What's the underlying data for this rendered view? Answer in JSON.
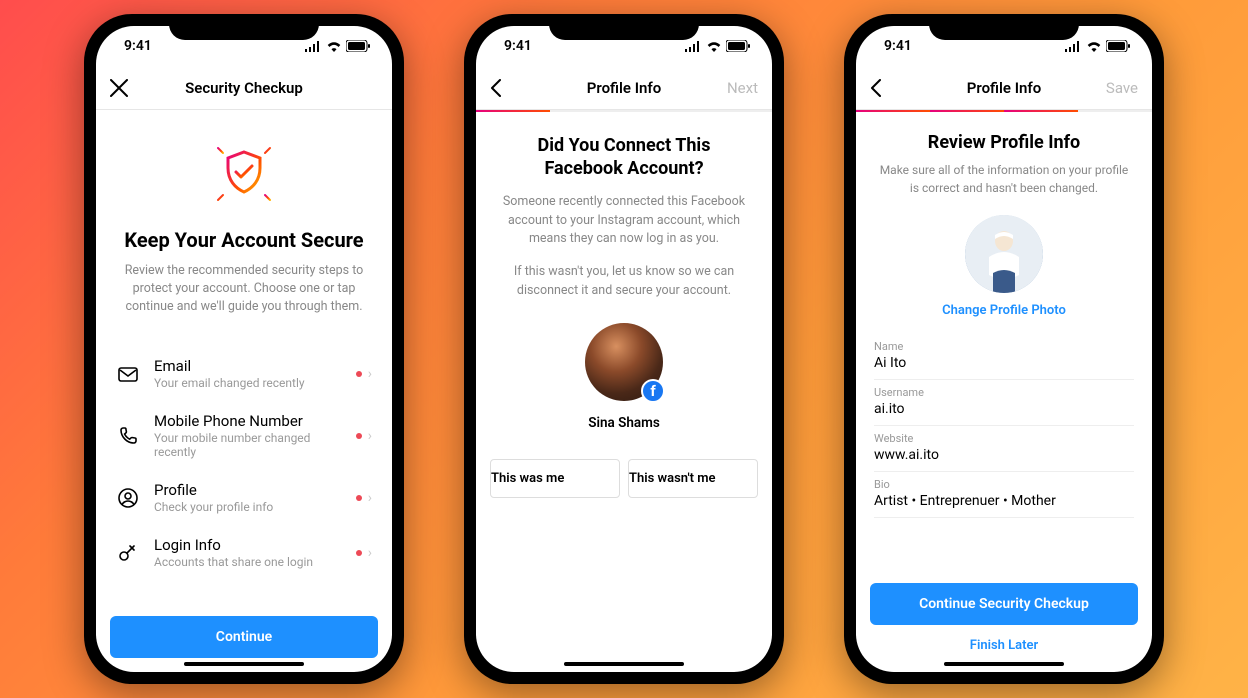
{
  "status": {
    "time": "9:41"
  },
  "screen1": {
    "nav_title": "Security Checkup",
    "hero_title": "Keep Your Account Secure",
    "hero_sub": "Review the recommended security steps to protect your account. Choose one or tap continue and we'll guide you through them.",
    "items": [
      {
        "title": "Email",
        "sub": "Your email changed recently"
      },
      {
        "title": "Mobile Phone Number",
        "sub": "Your mobile number changed recently"
      },
      {
        "title": "Profile",
        "sub": "Check your profile info"
      },
      {
        "title": "Login Info",
        "sub": "Accounts that share one login"
      }
    ],
    "continue_label": "Continue"
  },
  "screen2": {
    "nav_title": "Profile Info",
    "nav_right": "Next",
    "h1": "Did You Connect This Facebook Account?",
    "p1": "Someone recently connected this Facebook account to your Instagram account, which means they can now log in as you.",
    "p2": "If this wasn't you, let us know so we can disconnect it and secure your account.",
    "avatar_name": "Sina Shams",
    "btn_yes": "This was me",
    "btn_no": "This wasn't me"
  },
  "screen3": {
    "nav_title": "Profile Info",
    "nav_right": "Save",
    "h1": "Review Profile Info",
    "sub": "Make sure all of the information on your profile is correct and hasn't been changed.",
    "change_photo": "Change Profile Photo",
    "fields": [
      {
        "label": "Name",
        "value": "Ai Ito"
      },
      {
        "label": "Username",
        "value": "ai.ito"
      },
      {
        "label": "Website",
        "value": "www.ai.ito"
      },
      {
        "label": "Bio",
        "value": "Artist • Entreprenuer • Mother"
      }
    ],
    "btn_continue": "Continue Security Checkup",
    "btn_later": "Finish Later"
  }
}
